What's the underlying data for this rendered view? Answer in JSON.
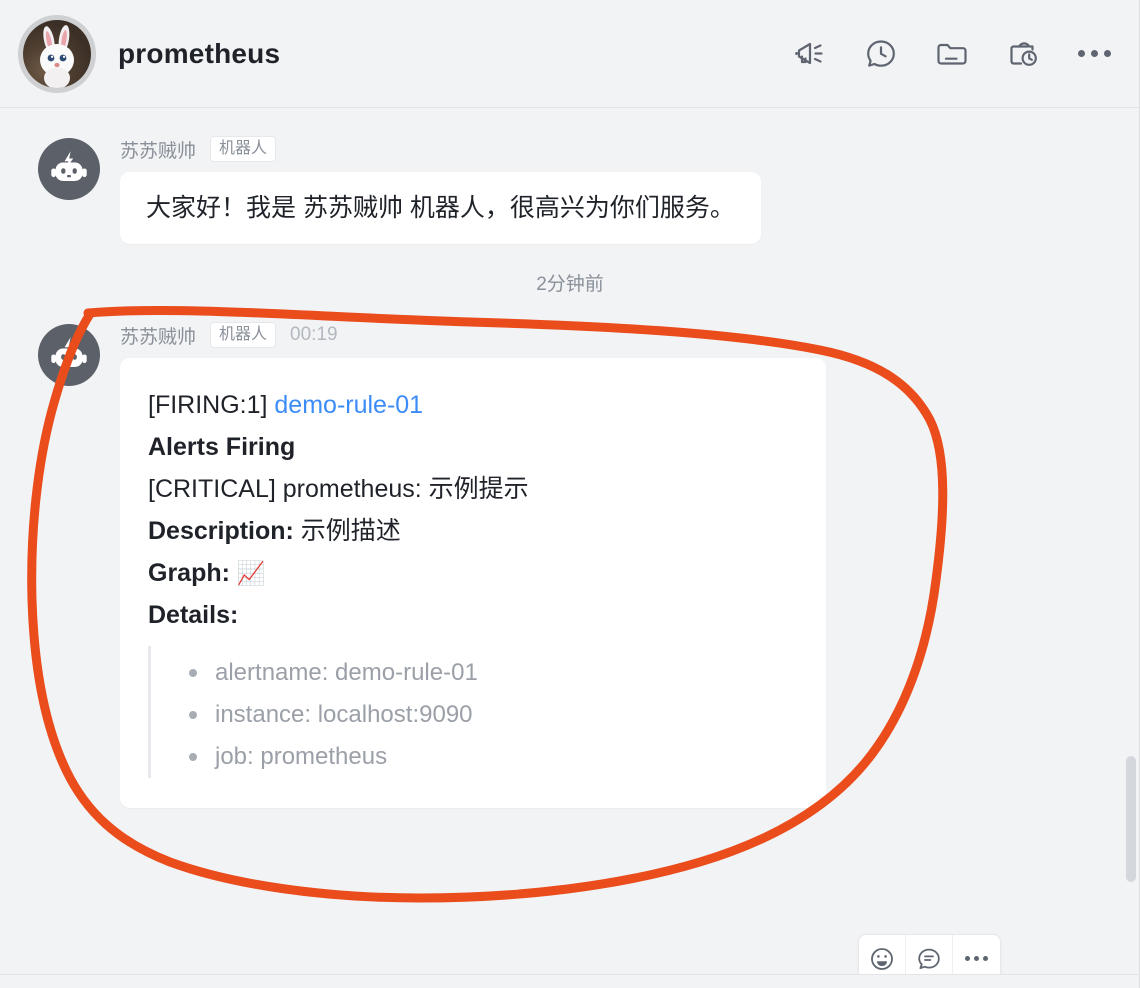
{
  "header": {
    "title": "prometheus",
    "avatar_icon": "rabbit-photo-avatar",
    "actions": [
      {
        "name": "announcement-icon",
        "label": "群公告"
      },
      {
        "name": "chat-history-icon",
        "label": "聊天记录"
      },
      {
        "name": "folder-icon",
        "label": "群文件"
      },
      {
        "name": "schedule-icon",
        "label": "日程"
      },
      {
        "name": "more-icon",
        "label": "更多"
      }
    ]
  },
  "messages": [
    {
      "id": "msg-greeting",
      "sender": "苏苏贼帅",
      "badge": "机器人",
      "time": "",
      "avatar_icon": "robot-avatar",
      "text": "大家好！我是 苏苏贼帅 机器人，很高兴为你们服务。"
    },
    {
      "id": "msg-alert",
      "sender": "苏苏贼帅",
      "badge": "机器人",
      "time": "00:19",
      "avatar_icon": "robot-avatar",
      "alert": {
        "title_prefix": "[FIRING:1] ",
        "title_link": "demo-rule-01",
        "heading": "Alerts Firing",
        "summary": "[CRITICAL] prometheus: 示例提示",
        "description_label": "Description: ",
        "description_value": "示例描述",
        "graph_label": "Graph: ",
        "graph_emoji": "📈",
        "details_label": "Details:",
        "details": [
          "alertname: demo-rule-01",
          "instance: localhost:9090",
          "job: prometheus"
        ]
      }
    }
  ],
  "time_divider": "2分钟前",
  "message_actions": [
    {
      "name": "emoji-reaction-button",
      "label": "表情回复"
    },
    {
      "name": "reply-button",
      "label": "回复"
    },
    {
      "name": "more-actions-button",
      "label": "更多"
    }
  ],
  "annotation": {
    "shape": "hand-drawn-circle",
    "color": "#ea4c1c",
    "stroke_width": 9
  },
  "colors": {
    "background": "#f2f3f5",
    "bubble": "#ffffff",
    "link": "#3c8cf8",
    "text_primary": "#1f2329",
    "text_secondary": "#8a9099",
    "text_muted": "#9ba0a8",
    "annotation": "#ea4c1c"
  }
}
